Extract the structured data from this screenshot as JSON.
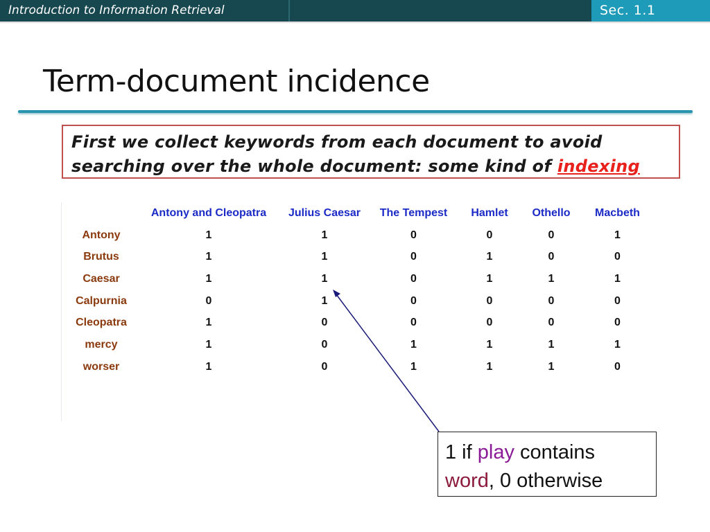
{
  "header": {
    "course_title": "Introduction to Information Retrieval",
    "section": "Sec. 1.1"
  },
  "slide": {
    "title": "Term-document incidence"
  },
  "callout": {
    "text_before": "First we collect keywords from each document to avoid searching over the whole document: some kind of ",
    "highlight": "indexing"
  },
  "matrix": {
    "columns": [
      "Antony and Cleopatra",
      "Julius Caesar",
      "The Tempest",
      "Hamlet",
      "Othello",
      "Macbeth"
    ],
    "rows": [
      {
        "term": "Antony",
        "values": [
          "1",
          "1",
          "0",
          "0",
          "0",
          "1"
        ]
      },
      {
        "term": "Brutus",
        "values": [
          "1",
          "1",
          "0",
          "1",
          "0",
          "0"
        ]
      },
      {
        "term": "Caesar",
        "values": [
          "1",
          "1",
          "0",
          "1",
          "1",
          "1"
        ]
      },
      {
        "term": "Calpurnia",
        "values": [
          "0",
          "1",
          "0",
          "0",
          "0",
          "0"
        ]
      },
      {
        "term": "Cleopatra",
        "values": [
          "1",
          "0",
          "0",
          "0",
          "0",
          "0"
        ]
      },
      {
        "term": "mercy",
        "values": [
          "1",
          "0",
          "1",
          "1",
          "1",
          "1"
        ]
      },
      {
        "term": "worser",
        "values": [
          "1",
          "0",
          "1",
          "1",
          "1",
          "0"
        ]
      }
    ]
  },
  "note": {
    "part1": "1 if ",
    "play": "play",
    "part2": " contains",
    "word": "word",
    "part3": ", 0 otherwise"
  },
  "colors": {
    "header_bg": "#17484f",
    "section_bg": "#1e9bb8",
    "title_rule": "#2894ad",
    "callout_border": "#c0504d",
    "highlight": "#e8211c",
    "column_header": "#1c2bc7",
    "row_label": "#8b3a0e",
    "arrow": "#1a1a7a"
  }
}
